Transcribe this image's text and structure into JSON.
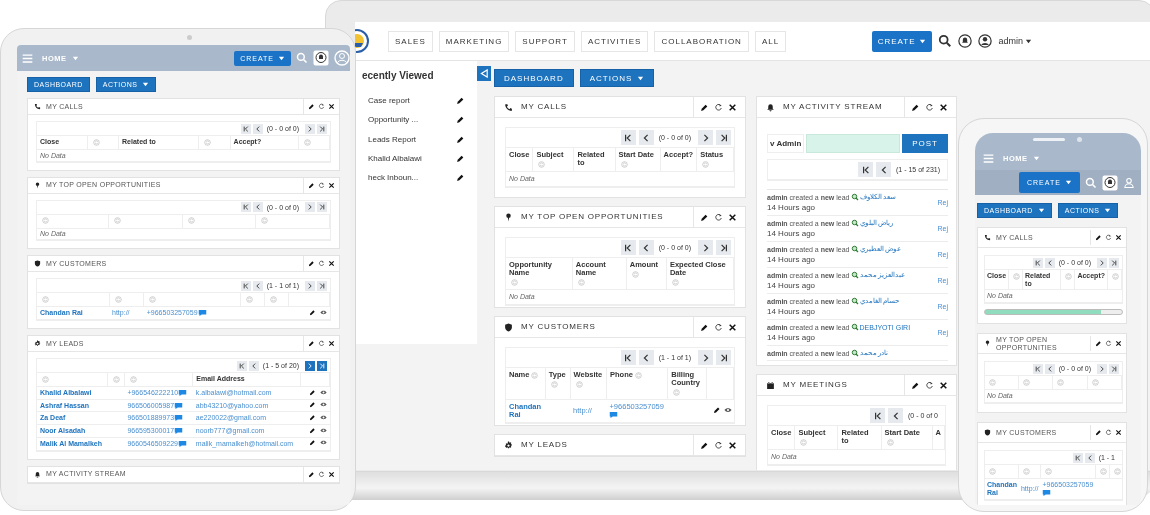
{
  "devices": [
    {
      "kind": "tablet",
      "home": "HOME",
      "create": "CREATE",
      "buttons": [
        {
          "label": "DASHBOARD",
          "caret": false
        },
        {
          "label": "ACTIONS",
          "caret": true
        }
      ],
      "columns": [
        [
          {
            "kind": "calls",
            "title": "MY CALLS",
            "pager": {
              "text": "(0 - 0 of 0)",
              "next_shown": true,
              "next_enabled": false
            },
            "columns": [
              {
                "label": "Close",
                "sortable": false
              },
              {
                "sortable": true
              },
              {
                "label": "Related to",
                "sortable": false
              },
              {
                "sortable": true
              },
              {
                "label": "Accept?",
                "sortable": false
              },
              {
                "sortable": true
              }
            ],
            "no_data": "No Data"
          },
          {
            "kind": "opportunities",
            "title": "MY TOP OPEN OPPORTUNITIES",
            "pager": {
              "text": "(0 - 0 of 0)",
              "next_shown": true,
              "next_enabled": false
            },
            "columns": [
              {
                "sortable": true
              },
              {
                "sortable": true
              },
              {
                "sortable": true
              },
              {
                "sortable": true
              }
            ],
            "no_data": "No Data"
          },
          {
            "kind": "customers",
            "title": "MY CUSTOMERS",
            "pager": {
              "text": "(1 - 1 of 1)",
              "next_shown": true,
              "next_enabled": false
            },
            "columns": [
              {
                "sortable": true
              },
              {
                "sortable": true
              },
              {
                "sortable": true
              },
              {
                "sortable": true
              },
              {
                "sortable": true
              }
            ],
            "rows": [
              {
                "actions": true,
                "cells": [
                  {
                    "kind": "name",
                    "text": "Chandan Rai"
                  },
                  {
                    "kind": "url",
                    "text": "http://"
                  },
                  {
                    "kind": "phone",
                    "text": "+966503257059"
                  },
                  {
                    "kind": "empty"
                  },
                  {
                    "kind": "empty"
                  }
                ]
              }
            ]
          },
          {
            "kind": "leads",
            "title": "MY LEADS",
            "pager": {
              "text": "(1 - 5 of 20)",
              "next_shown": true,
              "next_enabled": true
            },
            "columns": [
              {
                "sortable": true
              },
              {
                "sortable": true
              },
              {
                "sortable": true
              },
              {
                "label": "Email Address",
                "sortable": false
              }
            ],
            "rows": [
              {
                "actions": true,
                "cells": [
                  {
                    "kind": "name",
                    "text": "Khalid Albalawi"
                  },
                  {
                    "kind": "empty"
                  },
                  {
                    "kind": "phone",
                    "text": "+966546222210"
                  },
                  {
                    "kind": "email",
                    "text": "k.albalawi@hotmail.com"
                  }
                ]
              },
              {
                "actions": true,
                "cells": [
                  {
                    "kind": "name",
                    "text": "Ashraf Hassan"
                  },
                  {
                    "kind": "empty"
                  },
                  {
                    "kind": "phone",
                    "text": "966506005987"
                  },
                  {
                    "kind": "email",
                    "text": "abb43210@yahoo.com"
                  }
                ]
              },
              {
                "actions": true,
                "cells": [
                  {
                    "kind": "name",
                    "text": "Za Deaf"
                  },
                  {
                    "kind": "empty"
                  },
                  {
                    "kind": "phone",
                    "text": "966501889973"
                  },
                  {
                    "kind": "email",
                    "text": "ae220022@gmail.com"
                  }
                ]
              },
              {
                "actions": true,
                "cells": [
                  {
                    "kind": "name",
                    "text": "Noor Alsadah"
                  },
                  {
                    "kind": "empty"
                  },
                  {
                    "kind": "phone",
                    "text": "966595300017"
                  },
                  {
                    "kind": "email",
                    "text": "noorb777@gmail.com"
                  }
                ]
              },
              {
                "actions": true,
                "cells": [
                  {
                    "kind": "name",
                    "text": "Malik Al Mamalkeh"
                  },
                  {
                    "kind": "empty"
                  },
                  {
                    "kind": "phone",
                    "text": "9660546509229"
                  },
                  {
                    "kind": "email",
                    "text": "malik_mamalkeh@hotmail.com"
                  }
                ]
              }
            ]
          },
          {
            "kind": "activity",
            "title": "MY ACTIVITY STREAM"
          }
        ]
      ]
    },
    {
      "kind": "laptop",
      "nav_tabs": [
        "SALES",
        "MARKETING",
        "SUPPORT",
        "ACTIVITIES",
        "COLLABORATION",
        "ALL"
      ],
      "create": "CREATE",
      "user": "admin",
      "recently_viewed": {
        "title": "ecently Viewed",
        "items": [
          "Case report",
          "Opportunity ...",
          "Leads Report",
          "Khalid Albalawi",
          "heck Inboun..."
        ]
      },
      "buttons": [
        {
          "label": "DASHBOARD",
          "caret": false
        },
        {
          "label": "ACTIONS",
          "caret": true
        }
      ],
      "columns": [
        [
          {
            "kind": "calls",
            "title": "MY CALLS",
            "pager": {
              "text": "(0 - 0 of 0)",
              "next_shown": true,
              "next_enabled": false
            },
            "columns": [
              {
                "label": "Close",
                "sortable": false
              },
              {
                "label": "Subject",
                "sortable": true
              },
              {
                "label": "Related to",
                "sortable": false
              },
              {
                "label": "Start Date",
                "sortable": true
              },
              {
                "label": "Accept?",
                "sortable": false
              },
              {
                "label": "Status",
                "sortable": true
              }
            ],
            "no_data": "No Data"
          },
          {
            "kind": "opportunities",
            "title": "MY TOP OPEN OPPORTUNITIES",
            "pager": {
              "text": "(0 - 0 of 0)",
              "next_shown": true,
              "next_enabled": false
            },
            "columns": [
              {
                "label": "Opportunity Name",
                "sortable": true
              },
              {
                "label": "Account Name",
                "sortable": true
              },
              {
                "label": "Amount",
                "sortable": true
              },
              {
                "label": "Expected Close Date",
                "sortable": true
              }
            ],
            "no_data": "No Data"
          },
          {
            "kind": "customers",
            "title": "MY CUSTOMERS",
            "pager": {
              "text": "(1 - 1 of 1)",
              "next_shown": true,
              "next_enabled": false
            },
            "columns": [
              {
                "label": "Name",
                "sortable": true
              },
              {
                "label": "Type",
                "sortable": true
              },
              {
                "label": "Website",
                "sortable": true
              },
              {
                "label": "Phone",
                "sortable": true
              },
              {
                "label": "Billing Country",
                "sortable": true
              }
            ],
            "rows": [
              {
                "actions": true,
                "cells": [
                  {
                    "kind": "name",
                    "text": "Chandan Rai"
                  },
                  {
                    "kind": "empty"
                  },
                  {
                    "kind": "url",
                    "text": "http://"
                  },
                  {
                    "kind": "phone",
                    "text": "+966503257059"
                  },
                  {
                    "kind": "empty"
                  }
                ]
              }
            ]
          },
          {
            "kind": "leads",
            "title": "MY LEADS"
          }
        ],
        [
          {
            "kind": "activity",
            "title": "MY ACTIVITY STREAM",
            "post": {
              "label": "v Admin",
              "button": "POST"
            },
            "pager": {
              "text": "(1 - 15 of 231)",
              "next_shown": false
            },
            "entries": [
              {
                "text": "**admin** created a **new** lead",
                "lead": "سعد الكلاوف",
                "time": "14 Hours ago",
                "reply": "Rej"
              },
              {
                "text": "**admin** created a **new** lead",
                "lead": "رياض البلوي",
                "time": "14 Hours ago",
                "reply": "Rej"
              },
              {
                "text": "**admin** created a **new** lead",
                "lead": "عوض العطيري",
                "time": "14 Hours ago",
                "reply": "Rej"
              },
              {
                "text": "**admin** created a **new** lead",
                "lead": "عبدالعزيز محمد",
                "time": "14 Hours ago",
                "reply": "Rej"
              },
              {
                "text": "**admin** created a **new** lead",
                "lead": "حسام الغامدي",
                "time": "14 Hours ago",
                "reply": "Rej"
              },
              {
                "text": "**admin** created a **new** lead",
                "lead": "DEBJYOTI GIRI",
                "time": "14 Hours ago",
                "reply": "Rej"
              },
              {
                "text": "**admin** created a **new** lead",
                "lead": "نادر محمد"
              }
            ]
          },
          {
            "kind": "meetings",
            "title": "MY MEETINGS",
            "pager": {
              "text": "(0 - 0 of 0",
              "next_shown": false
            },
            "columns": [
              {
                "label": "Close",
                "sortable": false
              },
              {
                "label": "Subject",
                "sortable": true
              },
              {
                "label": "Related to",
                "sortable": false
              },
              {
                "label": "Start Date",
                "sortable": true
              },
              {
                "label": "A",
                "sortable": false
              }
            ],
            "no_data": "No Data"
          }
        ]
      ]
    },
    {
      "kind": "phone",
      "home": "HOME",
      "create": "CREATE",
      "buttons": [
        {
          "label": "DASHBOARD",
          "caret": true
        },
        {
          "label": "ACTIONS",
          "caret": true
        }
      ],
      "columns": [
        [
          {
            "kind": "calls",
            "title": "MY CALLS",
            "pager": {
              "text": "(0 - 0 of 0)",
              "next_shown": true,
              "next_enabled": false
            },
            "columns": [
              {
                "label": "Close",
                "sortable": false
              },
              {
                "sortable": true
              },
              {
                "label": "Related to",
                "sortable": false
              },
              {
                "sortable": true
              },
              {
                "label": "Accept?",
                "sortable": false
              },
              {
                "sortable": true
              }
            ],
            "no_data": "No Data"
          },
          {
            "kind": "opportunities",
            "title": "MY TOP OPEN OPPORTUNITIES",
            "pager": {
              "text": "(0 - 0 of 0)",
              "next_shown": true,
              "next_enabled": false
            },
            "columns": [
              {
                "sortable": true
              },
              {
                "sortable": true
              },
              {
                "sortable": true
              },
              {
                "sortable": true
              }
            ],
            "no_data": "No Data"
          },
          {
            "kind": "customers",
            "title": "MY CUSTOMERS",
            "pager": {
              "text": "(1 - 1",
              "next_shown": false
            },
            "columns": [
              {
                "sortable": true
              },
              {
                "sortable": true
              },
              {
                "sortable": true
              },
              {
                "sortable": true
              },
              {
                "sortable": true
              }
            ],
            "rows": [
              {
                "cells": [
                  {
                    "kind": "name",
                    "text": "Chandan Rai"
                  },
                  {
                    "kind": "url",
                    "text": "http://"
                  },
                  {
                    "kind": "phone",
                    "text": "+966503257059"
                  },
                  {
                    "kind": "empty"
                  },
                  {
                    "kind": "empty"
                  }
                ]
              }
            ]
          }
        ]
      ]
    }
  ]
}
